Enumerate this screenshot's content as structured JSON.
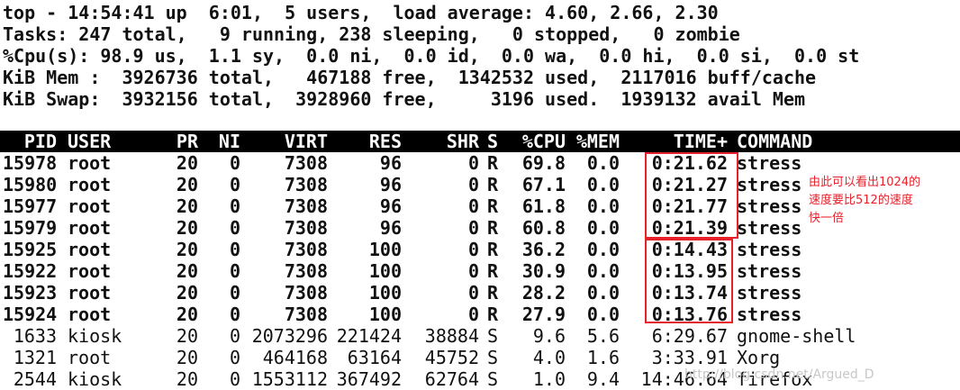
{
  "summary": {
    "line0": "top - 14:54:41 up  6:01,  5 users,  load average: 4.60, 2.66, 2.30",
    "line1": "Tasks: 247 total,   9 running, 238 sleeping,   0 stopped,   0 zombie",
    "line2": "%Cpu(s): 98.9 us,  1.1 sy,  0.0 ni,  0.0 id,  0.0 wa,  0.0 hi,  0.0 si,  0.0 st",
    "line3": "KiB Mem :  3926736 total,   467188 free,  1342532 used,  2117016 buff/cache",
    "line4": "KiB Swap:  3932156 total,  3928960 free,     3196 used.  1939132 avail Mem"
  },
  "header": {
    "pid": "PID",
    "user": "USER",
    "pr": "PR",
    "ni": "NI",
    "virt": "VIRT",
    "res": "RES",
    "shr": "SHR",
    "s": "S",
    "cpu": "%CPU",
    "mem": "%MEM",
    "time": "TIME+",
    "command": "COMMAND"
  },
  "processes": [
    {
      "pid": "15978",
      "user": "root",
      "pr": "20",
      "ni": "0",
      "virt": "7308",
      "res": "96",
      "shr": "0",
      "s": "R",
      "cpu": "69.8",
      "mem": "0.0",
      "time": "0:21.62",
      "command": "stress"
    },
    {
      "pid": "15980",
      "user": "root",
      "pr": "20",
      "ni": "0",
      "virt": "7308",
      "res": "96",
      "shr": "0",
      "s": "R",
      "cpu": "67.1",
      "mem": "0.0",
      "time": "0:21.27",
      "command": "stress"
    },
    {
      "pid": "15977",
      "user": "root",
      "pr": "20",
      "ni": "0",
      "virt": "7308",
      "res": "96",
      "shr": "0",
      "s": "R",
      "cpu": "61.8",
      "mem": "0.0",
      "time": "0:21.77",
      "command": "stress"
    },
    {
      "pid": "15979",
      "user": "root",
      "pr": "20",
      "ni": "0",
      "virt": "7308",
      "res": "96",
      "shr": "0",
      "s": "R",
      "cpu": "60.8",
      "mem": "0.0",
      "time": "0:21.39",
      "command": "stress"
    },
    {
      "pid": "15925",
      "user": "root",
      "pr": "20",
      "ni": "0",
      "virt": "7308",
      "res": "100",
      "shr": "0",
      "s": "R",
      "cpu": "36.2",
      "mem": "0.0",
      "time": "0:14.43",
      "command": "stress"
    },
    {
      "pid": "15922",
      "user": "root",
      "pr": "20",
      "ni": "0",
      "virt": "7308",
      "res": "100",
      "shr": "0",
      "s": "R",
      "cpu": "30.9",
      "mem": "0.0",
      "time": "0:13.95",
      "command": "stress"
    },
    {
      "pid": "15923",
      "user": "root",
      "pr": "20",
      "ni": "0",
      "virt": "7308",
      "res": "100",
      "shr": "0",
      "s": "R",
      "cpu": "28.2",
      "mem": "0.0",
      "time": "0:13.74",
      "command": "stress"
    },
    {
      "pid": "15924",
      "user": "root",
      "pr": "20",
      "ni": "0",
      "virt": "7308",
      "res": "100",
      "shr": "0",
      "s": "R",
      "cpu": "27.9",
      "mem": "0.0",
      "time": "0:13.76",
      "command": "stress"
    },
    {
      "pid": "1633",
      "user": "kiosk",
      "pr": "20",
      "ni": "0",
      "virt": "2073296",
      "res": "221424",
      "shr": "38884",
      "s": "S",
      "cpu": "9.6",
      "mem": "5.6",
      "time": "6:29.67",
      "command": "gnome-shell"
    },
    {
      "pid": "1321",
      "user": "root",
      "pr": "20",
      "ni": "0",
      "virt": "464168",
      "res": "63164",
      "shr": "45752",
      "s": "S",
      "cpu": "4.0",
      "mem": "1.6",
      "time": "3:33.91",
      "command": "Xorg"
    },
    {
      "pid": "2544",
      "user": "kiosk",
      "pr": "20",
      "ni": "0",
      "virt": "1553112",
      "res": "367492",
      "shr": "62764",
      "s": "S",
      "cpu": "1.0",
      "mem": "9.4",
      "time": "14:46.64",
      "command": "firefox"
    }
  ],
  "annotation": {
    "line1": "由此可以看出1024的",
    "line2": "速度要比512的速度",
    "line3": "快一倍",
    "color": "#e8202a"
  },
  "watermark": "http://blog.csdn.net/Argued_D"
}
